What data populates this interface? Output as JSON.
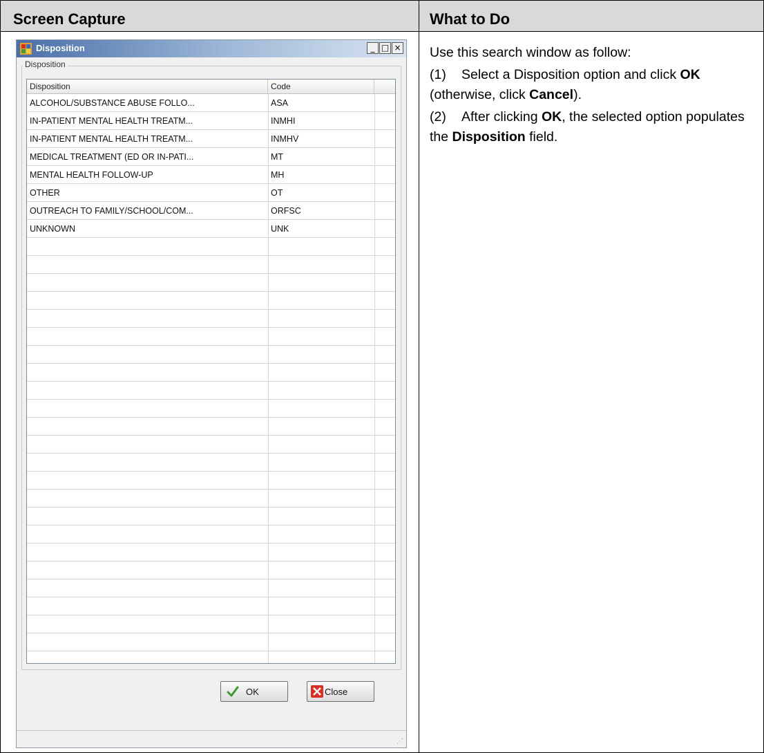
{
  "doc": {
    "header_left": "Screen Capture",
    "header_right": "What to Do",
    "instructions": {
      "intro": "Use this search window as follow:",
      "step1_num": "(1)",
      "step1_pre": "Select a Disposition option and click ",
      "step1_ok": "OK",
      "step1_mid": " (otherwise, click ",
      "step1_cancel": "Cancel",
      "step1_post": ").",
      "step2_num": "(2)",
      "step2_pre": "After clicking ",
      "step2_ok": "OK",
      "step2_mid": ", the selected option populates the ",
      "step2_field": "Disposition",
      "step2_post": " field."
    }
  },
  "dialog": {
    "title": "Disposition",
    "group_label": "Disposition",
    "columns": [
      "Disposition",
      "Code",
      ""
    ],
    "rows": [
      {
        "disposition": "ALCOHOL/SUBSTANCE ABUSE FOLLO...",
        "code": "ASA"
      },
      {
        "disposition": "IN-PATIENT MENTAL HEALTH TREATM...",
        "code": "INMHI"
      },
      {
        "disposition": "IN-PATIENT MENTAL HEALTH TREATM...",
        "code": "INMHV"
      },
      {
        "disposition": "MEDICAL TREATMENT (ED OR IN-PATI...",
        "code": "MT"
      },
      {
        "disposition": "MENTAL HEALTH FOLLOW-UP",
        "code": "MH"
      },
      {
        "disposition": "OTHER",
        "code": "OT"
      },
      {
        "disposition": "OUTREACH TO FAMILY/SCHOOL/COM...",
        "code": "ORFSC"
      },
      {
        "disposition": "UNKNOWN",
        "code": "UNK"
      }
    ],
    "ok_label": "OK",
    "close_label": "Close",
    "titlebar_buttons": {
      "minimize": "_",
      "maximize": "□",
      "close": "×"
    },
    "icons": {
      "app": "app-window-icon",
      "ok": "checkmark-icon",
      "close": "red-x-icon"
    }
  }
}
